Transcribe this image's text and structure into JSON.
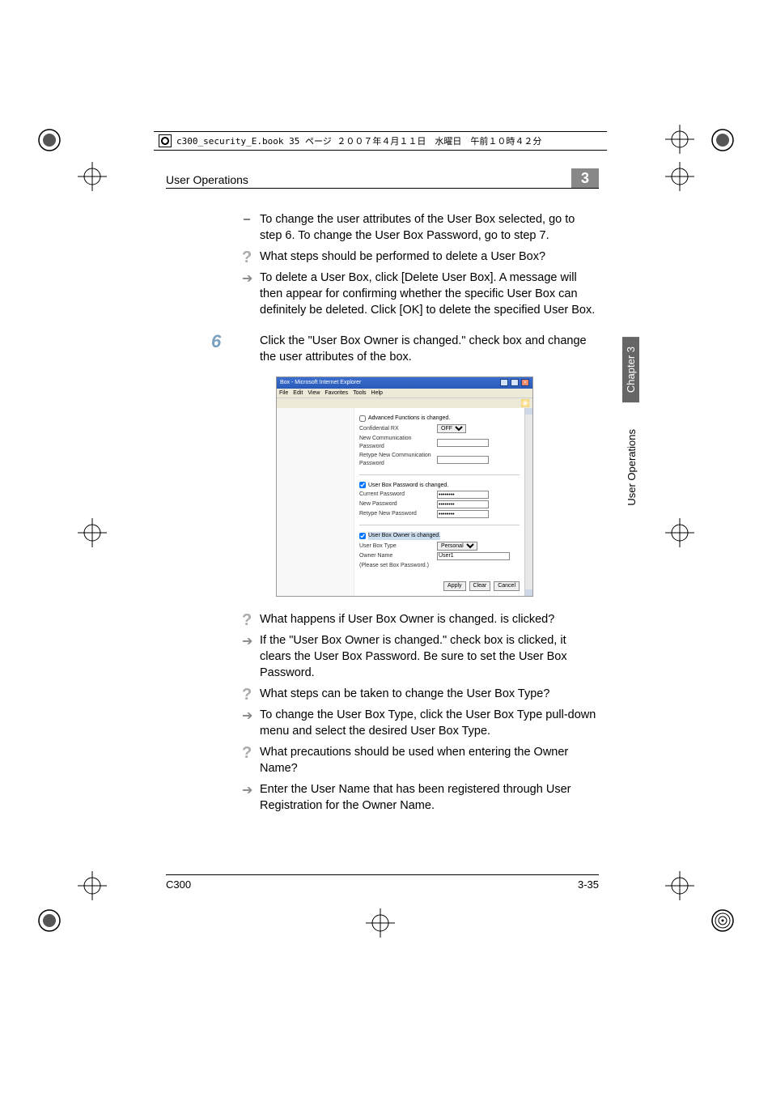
{
  "running_header": "c300_security_E.book  35 ページ  ２００７年４月１１日　水曜日　午前１０時４２分",
  "header": {
    "title": "User Operations",
    "chapter_num": "3"
  },
  "side": {
    "chapter": "Chapter 3",
    "section": "User Operations"
  },
  "footer": {
    "left": "C300",
    "right": "3-35"
  },
  "content": {
    "p1": "To change the user attributes of the User Box selected, go to step 6. To change the User Box Password, go to step 7.",
    "q1": "What steps should be performed to delete a User Box?",
    "a1": "To delete a User Box, click [Delete User Box]. A message will then appear for confirming whether the specific User Box can definitely be deleted. Click [OK] to delete the specified User Box.",
    "step6_num": "6",
    "step6": "Click the \"User Box Owner is changed.\" check box and change the user attributes of the box.",
    "q2": "What happens if User Box Owner is changed. is clicked?",
    "a2": "If the \"User Box Owner is changed.\" check box is clicked, it clears the User Box Password. Be sure to set the User Box Password.",
    "q3": "What steps can be taken to change the User Box Type?",
    "a3": "To change the User Box Type, click the User Box Type pull-down menu and select the desired User Box Type.",
    "q4": "What precautions should be used when entering the Owner Name?",
    "a4": "Enter the User Name that has been registered through User Registration for the Owner Name."
  },
  "shot": {
    "title": "Box - Microsoft Internet Explorer",
    "menu": [
      "File",
      "Edit",
      "View",
      "Favorites",
      "Tools",
      "Help"
    ],
    "g1_chk": "Advanced Functions is changed.",
    "g1_r1": "Confidential RX",
    "g1_r1_val": "OFF",
    "g1_r2": "New Communication Password",
    "g1_r3": "Retype New Communication Password",
    "g2_chk": "User Box Password is changed.",
    "g2_r1": "Current Password",
    "g2_r2": "New Password",
    "g2_r3": "Retype New Password",
    "g3_chk": "User Box Owner is changed.",
    "g3_r1": "User Box Type",
    "g3_r1_val": "Personal",
    "g3_r2": "Owner Name",
    "g3_r2_val": "User1",
    "g3_r3": "(Please set Box Password.)",
    "btn_apply": "Apply",
    "btn_clear": "Clear",
    "btn_cancel": "Cancel"
  }
}
